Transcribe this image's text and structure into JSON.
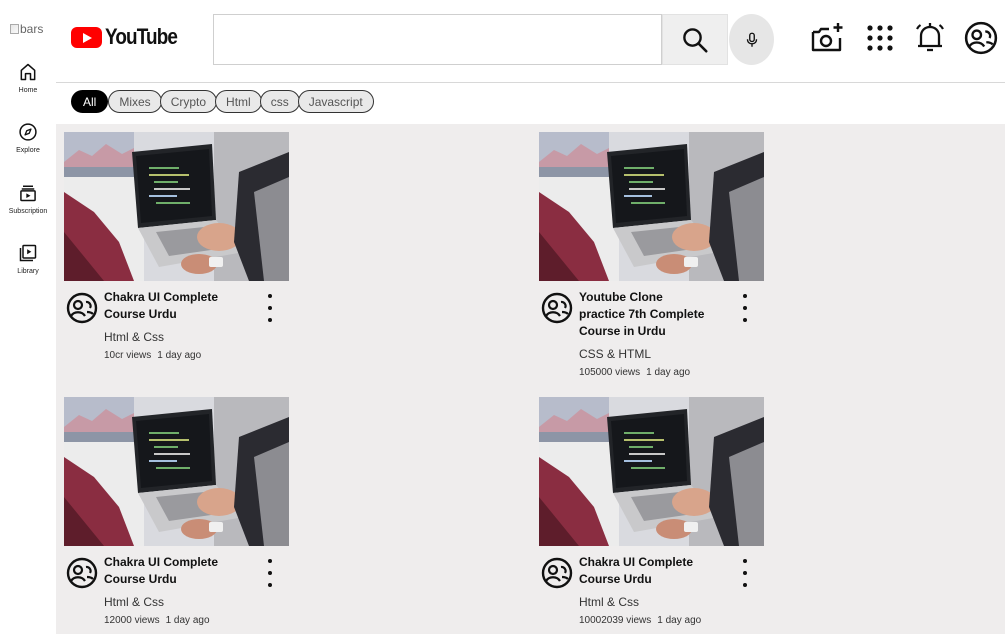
{
  "sidebar": {
    "menu_alt": "bars",
    "items": [
      {
        "label": "Home",
        "icon": "home-icon"
      },
      {
        "label": "Explore",
        "icon": "compass-icon"
      },
      {
        "label": "Subscription",
        "icon": "subscriptions-icon"
      },
      {
        "label": "Library",
        "icon": "library-icon"
      }
    ]
  },
  "header": {
    "logo_text": "YouTube",
    "search": {
      "value": "",
      "placeholder": ""
    },
    "icons": [
      "search-icon",
      "mic-icon",
      "create-video-icon",
      "apps-grid-icon",
      "notifications-bell-icon",
      "account-avatar-icon"
    ]
  },
  "chips": [
    "All",
    "Mixes",
    "Crypto",
    "Html",
    "css",
    "Javascript"
  ],
  "colors": {
    "brand_red": "#ff0000",
    "content_bg": "#efeded",
    "active_chip": "#000000"
  },
  "videos": [
    {
      "title": "Chakra UI Complete Course Urdu",
      "channel": "Html & Css",
      "views": "10cr views",
      "age": "1 day ago"
    },
    {
      "title": "Youtube Clone practice 7th Complete Course in Urdu",
      "channel": "CSS & HTML",
      "views": "105000 views",
      "age": "1 day ago"
    },
    {
      "title": "Chakra UI Complete Course Urdu",
      "channel": "Html & Css",
      "views": "12000 views",
      "age": "1 day ago"
    },
    {
      "title": "Chakra UI Complete Course Urdu",
      "channel": "Html & Css",
      "views": "10002039 views",
      "age": "1 day ago"
    }
  ]
}
